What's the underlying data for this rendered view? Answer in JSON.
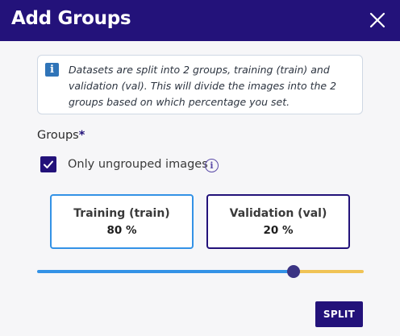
{
  "dialog": {
    "title": "Add Groups",
    "close_icon": "close-icon"
  },
  "info": {
    "icon": "info-icon",
    "icon_glyph": "i",
    "text": "Datasets are split into 2 groups, training (train) and validation (val). This will divide the images into the 2 groups based on which percentage you set."
  },
  "groups": {
    "label": "Groups",
    "required_mark": "*",
    "only_ungrouped": {
      "label": "Only ungrouped images",
      "checked": true,
      "help_icon": "info-circle-icon",
      "help_glyph": "i"
    },
    "training": {
      "title": "Training (train)",
      "value": "80 %"
    },
    "validation": {
      "title": "Validation (val)",
      "value": "20 %"
    },
    "slider": {
      "value": 0.785
    }
  },
  "actions": {
    "split_label": "SPLIT"
  },
  "colors": {
    "primary": "#23127a",
    "training_accent": "#3392e6",
    "validation_accent": "#f0c356",
    "info_icon": "#2f74b8"
  }
}
